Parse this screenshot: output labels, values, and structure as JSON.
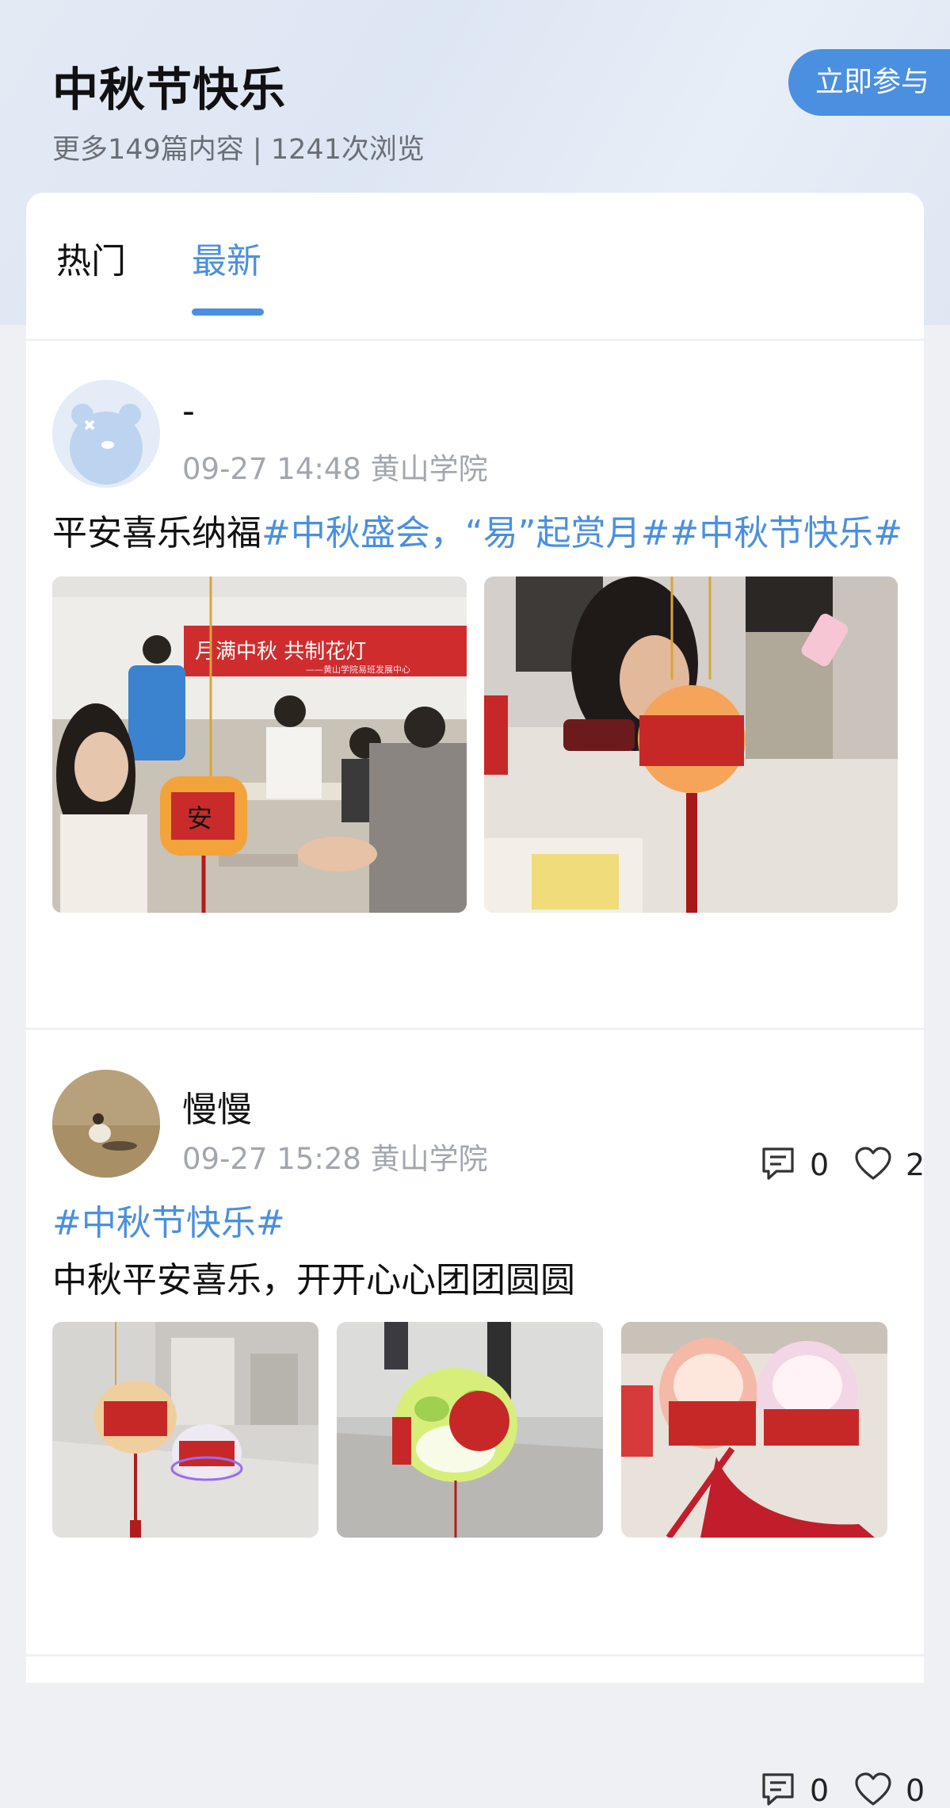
{
  "topic": {
    "title": "中秋节快乐",
    "stats": "更多149篇内容 | 1241次浏览",
    "join_label": "立即参与"
  },
  "tabs": [
    {
      "label": "热门",
      "active": false
    },
    {
      "label": "最新",
      "active": true
    }
  ],
  "posts": [
    {
      "author": "-",
      "meta": "09-27 14:48 黄山学院",
      "text_plain": "平安喜乐纳福",
      "text_tags": "#中秋盛会，“易”起赏月##中秋节快乐#",
      "images": [
        "photo-1",
        "photo-2"
      ],
      "comments": "0",
      "likes": "2"
    },
    {
      "author": "慢慢",
      "meta": "09-27 15:28 黄山学院",
      "tag_line": "#中秋节快乐#",
      "text_plain": "中秋平安喜乐，开开心心团团圆圆",
      "images": [
        "photo-1",
        "photo-2",
        "photo-3"
      ],
      "comments": "0",
      "likes": "0"
    }
  ],
  "photo_text": {
    "banner": "月满中秋  共制花灯",
    "banner_sub": "——黄山学院易班发展中心",
    "lantern_char": "安"
  },
  "colors": {
    "accent": "#4a8fe0",
    "tag_blue": "#4a8fe0",
    "meta_gray": "#a2a6ad"
  },
  "icons": [
    "comment-icon",
    "heart-icon",
    "avatar-bear-icon"
  ]
}
